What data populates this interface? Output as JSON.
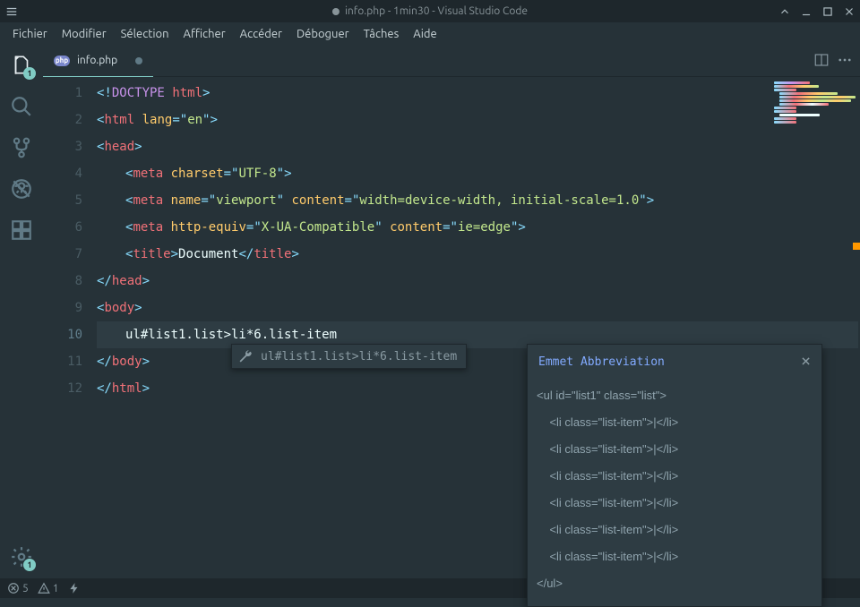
{
  "window": {
    "title": "info.php - 1min30 - Visual Studio Code"
  },
  "menu": [
    "Fichier",
    "Modifier",
    "Sélection",
    "Afficher",
    "Accéder",
    "Déboguer",
    "Tâches",
    "Aide"
  ],
  "activity": {
    "explorer_badge": "1",
    "settings_badge": "1"
  },
  "tab": {
    "filetype": "php",
    "filename": "info.php"
  },
  "code": {
    "l1_doctype": "DOCTYPE",
    "l1_html": "html",
    "l2_tag": "html",
    "l2_attr": "lang",
    "l2_val": "en",
    "l3_tag": "head",
    "l4_tag": "meta",
    "l4_attr": "charset",
    "l4_val": "UTF-8",
    "l5_tag": "meta",
    "l5_attr1": "name",
    "l5_val1": "viewport",
    "l5_attr2": "content",
    "l5_val2": "width=device-width, initial-scale=1.0",
    "l6_tag": "meta",
    "l6_attr1": "http-equiv",
    "l6_val1": "X-UA-Compatible",
    "l6_attr2": "content",
    "l6_val2": "ie=edge",
    "l7_tag": "title",
    "l7_text": "Document",
    "l8_tag": "head",
    "l9_tag": "body",
    "l10_text": "ul#list1.list>li*6.list-item",
    "l11_tag": "body",
    "l12_tag": "html"
  },
  "tooltip": {
    "text": "ul#list1.list>li*6.list-item"
  },
  "emmet": {
    "title": "Emmet Abbreviation",
    "open": "<ul id=\"list1\" class=\"list\">",
    "li": "<li class=\"list-item\">|</li>",
    "close": "</ul>"
  },
  "status": {
    "errors": "5",
    "warnings": "1"
  }
}
